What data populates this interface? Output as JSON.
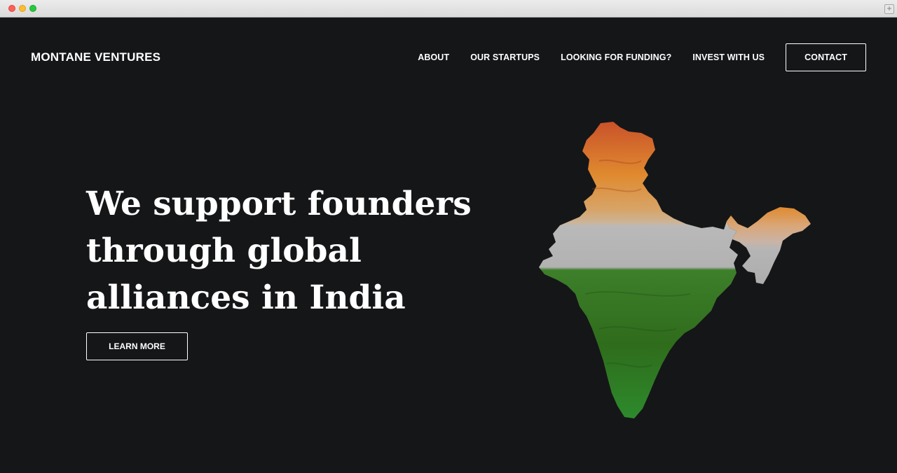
{
  "header": {
    "brand": "MONTANE VENTURES",
    "nav": [
      {
        "label": "ABOUT"
      },
      {
        "label": "OUR STARTUPS"
      },
      {
        "label": "LOOKING FOR FUNDING?"
      },
      {
        "label": "INVEST WITH US"
      },
      {
        "label": "CONTACT"
      }
    ]
  },
  "hero": {
    "title": "We support founders through global alliances in India",
    "cta_label": "LEARN MORE"
  },
  "colors": {
    "background": "#151618",
    "text": "#ffffff",
    "saffron": "#d9842b",
    "white_band": "#b7b7b7",
    "green": "#2f7a1f"
  },
  "icons": {
    "newtab": "plus-icon",
    "map": "india-map-flag-image"
  }
}
